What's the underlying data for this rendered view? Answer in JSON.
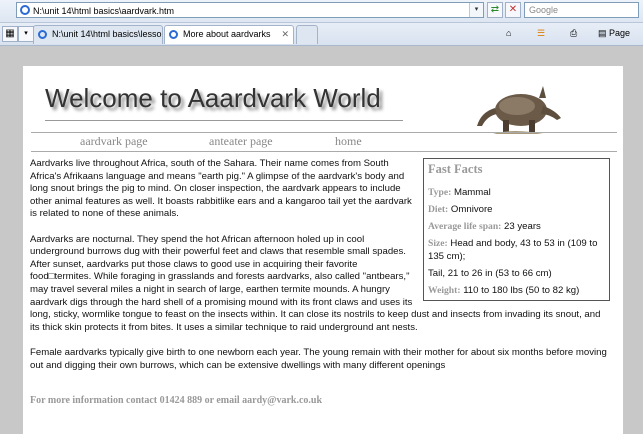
{
  "browser": {
    "address": "N:\\unit 14\\html basics\\aardvark.htm",
    "search_placeholder": "Google",
    "tabs": [
      {
        "label": "N:\\unit 14\\html basics\\lesson..."
      },
      {
        "label": "More about aardvarks"
      }
    ],
    "page_menu": "Page",
    "dropdown_glyph": "▾",
    "refresh_glyph": "⇄",
    "stop_glyph": "✕",
    "close_glyph": "✕"
  },
  "page": {
    "title": "Welcome to Aaardvark World",
    "nav": [
      {
        "label": "aardvark page"
      },
      {
        "label": "anteater page"
      },
      {
        "label": "home"
      }
    ],
    "paragraphs": [
      "Aardvarks live throughout Africa, south of the Sahara. Their name comes from South Africa's Afrikaans language and means \"earth pig.\" A glimpse of the aardvark's body and long snout brings the pig to mind. On closer inspection, the aardvark appears to include other animal features as well. It boasts rabbitlike ears and a kangaroo tail yet the aardvark is related to none of these animals.",
      "Aardvarks are nocturnal. They spend the hot African afternoon holed up in cool underground burrows dug with their powerful feet and claws that resemble small spades. After sunset, aardvarks put those claws to good use in acquiring their favorite food□termites. While foraging in grasslands and forests aardvarks, also called \"antbears,\" may travel several miles a night in search of large, earthen termite mounds. A hungry aardvark digs through the hard shell of a promising mound with its front claws and uses its long, sticky, wormlike tongue to feast on the insects within. It can close its nostrils to keep dust and insects from invading its snout, and its thick skin protects it from bites. It uses a similar technique to raid underground ant nests.",
      "Female aardvarks typically give birth to one newborn each year. The young remain with their mother for about six months before moving out and digging their own burrows, which can be extensive dwellings with many different openings"
    ],
    "facts": {
      "heading": "Fast Facts",
      "rows": [
        {
          "k": "Type:",
          "v": "Mammal"
        },
        {
          "k": "Diet:",
          "v": "Omnivore"
        },
        {
          "k": "Average life span:",
          "v": "23 years"
        },
        {
          "k": "Size:",
          "v": "Head and body, 43 to 53 in (109 to 135 cm);"
        },
        {
          "k": "",
          "v": "Tail, 21 to 26 in (53 to 66 cm)"
        },
        {
          "k": "Weight:",
          "v": "110 to 180 lbs (50 to 82 kg)"
        }
      ]
    },
    "footer": "For more information contact 01424 889 or email aardy@vark.co.uk"
  }
}
